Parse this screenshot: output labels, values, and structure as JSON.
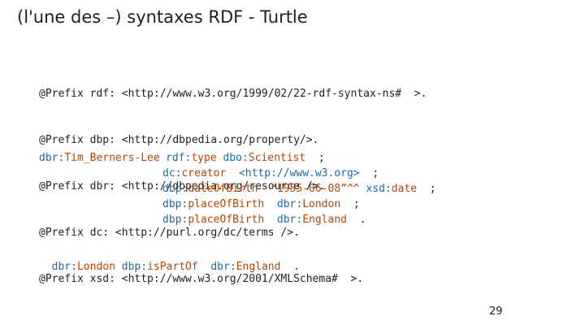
{
  "slide": {
    "title": "(l'une des –) syntaxes RDF - Turtle",
    "page_number": "29"
  },
  "prefixes": {
    "0": "@Prefix rdf: <http://www.w3.org/1999/02/22-rdf-syntax-ns#  >.",
    "1": "@Prefix dbp: <http://dbpedia.org/property/>.",
    "2": "@Prefix dbr: <http://dbpedia.org/resource />.",
    "3": "@Prefix dc: <http://purl.org/dc/terms />.",
    "4": "@Prefix xsd: <http://www.w3.org/2001/XMLSchema#  >."
  },
  "triples": {
    "subject_prefix": "dbr:",
    "subject_local": "Tim_Berners-Lee",
    "s1_pred_prefix": "rdf:",
    "s1_pred_local": "type",
    "s1_obj_prefix": "dbo:",
    "s1_obj_local": "Scientist",
    "s1_end": ";",
    "s2_pred_prefix": "dc:",
    "s2_pred_local": "creator",
    "s2_obj": "<http://www.w3.org>",
    "s2_end": ";",
    "s3_pred_prefix": "dbp:",
    "s3_pred_local": "dateOfBirth",
    "s3_literal": "“1955-06-08”^^",
    "s3_type_prefix": "xsd:",
    "s3_type_local": "date",
    "s3_end": ";",
    "s4_pred_prefix": "dbp:",
    "s4_pred_local": "placeOfBirth",
    "s4_obj_prefix": "dbr:",
    "s4_obj_local": "London",
    "s4_end": ";",
    "s5_pred_prefix": "dbp:",
    "s5_pred_local": "placeOfBirth",
    "s5_obj_prefix": "dbr:",
    "s5_obj_local": "England",
    "s5_end": "."
  },
  "triple2": {
    "subj_prefix": "dbr:",
    "subj_local": "London",
    "pred_prefix": "dbp:",
    "pred_local": "isPartOf",
    "obj_prefix": "dbr:",
    "obj_local": "England",
    "end": "."
  },
  "colors": {
    "blue": "#1a6aa8",
    "orange": "#b34500"
  }
}
